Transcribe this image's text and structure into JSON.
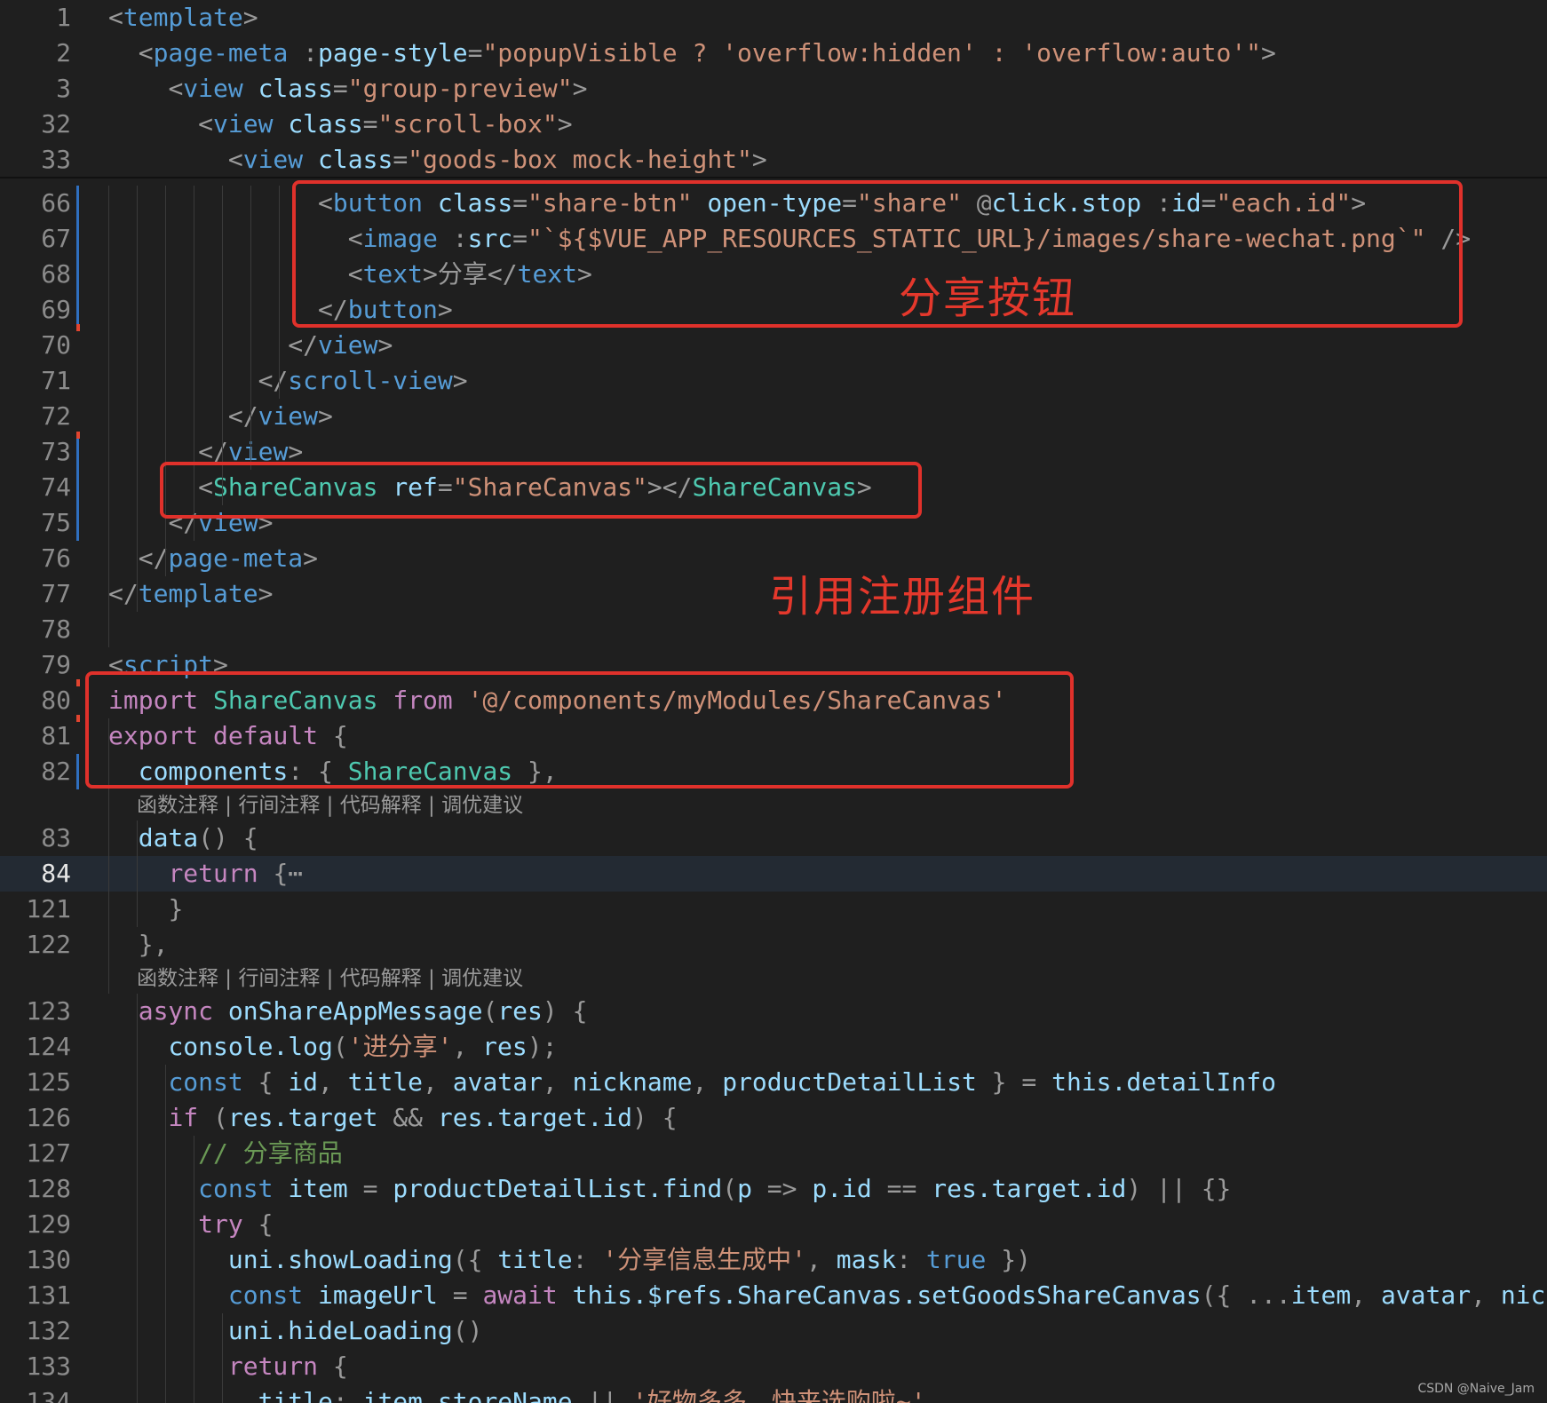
{
  "editor": {
    "language": "vue",
    "theme_colors": {
      "background": "#1f1f1f",
      "current_line": "#232a33",
      "tag": "#569cd6",
      "component_tag": "#4ec9b0",
      "attribute": "#9cdcfe",
      "string": "#ce9178",
      "keyword": "#c586c0",
      "storage": "#569cd6",
      "function": "#dcdcaa",
      "comment": "#6a9955",
      "annotation_red": "#e0312b"
    },
    "lines": [
      {
        "num": "1",
        "text": "<template>"
      },
      {
        "num": "2",
        "text": "  <page-meta :page-style=\"popupVisible ? 'overflow:hidden' : 'overflow:auto'\">"
      },
      {
        "num": "3",
        "text": "    <view class=\"group-preview\">"
      },
      {
        "num": "32",
        "text": "      <view class=\"scroll-box\">"
      },
      {
        "num": "33",
        "text": "        <view class=\"goods-box mock-height\">"
      },
      {
        "num": "66",
        "text": "              <button class=\"share-btn\" open-type=\"share\" @click.stop :id=\"each.id\">"
      },
      {
        "num": "67",
        "text": "                <image :src=\"`${$VUE_APP_RESOURCES_STATIC_URL}/images/share-wechat.png`\" />"
      },
      {
        "num": "68",
        "text": "                <text>分享</text>"
      },
      {
        "num": "69",
        "text": "              </button>"
      },
      {
        "num": "70",
        "text": "            </view>"
      },
      {
        "num": "71",
        "text": "          </scroll-view>"
      },
      {
        "num": "72",
        "text": "        </view>"
      },
      {
        "num": "73",
        "text": "      </view>"
      },
      {
        "num": "74",
        "text": "      <ShareCanvas ref=\"ShareCanvas\"></ShareCanvas>"
      },
      {
        "num": "75",
        "text": "    </view>"
      },
      {
        "num": "76",
        "text": "  </page-meta>"
      },
      {
        "num": "77",
        "text": "</template>"
      },
      {
        "num": "78",
        "text": ""
      },
      {
        "num": "79",
        "text": "<script>"
      },
      {
        "num": "80",
        "text": "import ShareCanvas from '@/components/myModules/ShareCanvas'"
      },
      {
        "num": "81",
        "text": "export default {"
      },
      {
        "num": "82",
        "text": "  components: { ShareCanvas },"
      },
      {
        "num": "83",
        "text": "  data() {"
      },
      {
        "num": "84",
        "text": "    return {⋯"
      },
      {
        "num": "121",
        "text": "    }"
      },
      {
        "num": "122",
        "text": "  },"
      },
      {
        "num": "123",
        "text": "  async onShareAppMessage(res) {"
      },
      {
        "num": "124",
        "text": "    console.log('进分享', res);"
      },
      {
        "num": "125",
        "text": "    const { id, title, avatar, nickname, productDetailList } = this.detailInfo"
      },
      {
        "num": "126",
        "text": "    if (res.target && res.target.id) {"
      },
      {
        "num": "127",
        "text": "      // 分享商品"
      },
      {
        "num": "128",
        "text": "      const item = productDetailList.find(p => p.id == res.target.id) || {}"
      },
      {
        "num": "129",
        "text": "      try {"
      },
      {
        "num": "130",
        "text": "        uni.showLoading({ title: '分享信息生成中', mask: true })"
      },
      {
        "num": "131",
        "text": "        const imageUrl = await this.$refs.ShareCanvas.setGoodsShareCanvas({ ...item, avatar, nickname"
      },
      {
        "num": "132",
        "text": "        uni.hideLoading()"
      },
      {
        "num": "133",
        "text": "        return {"
      },
      {
        "num": "134",
        "text": "          title: item.storeName || '好物多多，快来选购啦~'"
      }
    ],
    "codelens": [
      {
        "text": "函数注释 | 行间注释 | 代码解释 | 调优建议"
      },
      {
        "text": "函数注释 | 行间注释 | 代码解释 | 调优建议"
      }
    ]
  },
  "annotations": {
    "share_button": "分享按钮",
    "use_component": "引用注册组件"
  },
  "watermark": "CSDN @Naive_Jam"
}
